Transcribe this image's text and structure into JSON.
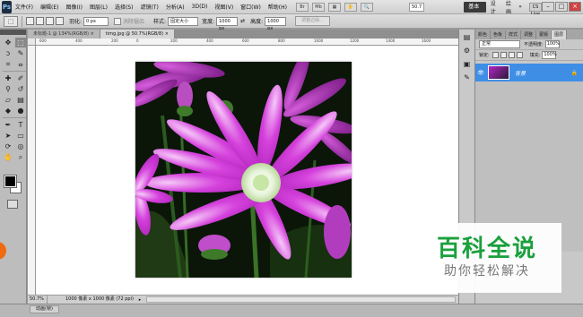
{
  "menubar": {
    "logo": "Ps",
    "items": [
      "文件(F)",
      "编辑(E)",
      "图像(I)",
      "图层(L)",
      "选择(S)",
      "滤镜(T)",
      "分析(A)",
      "3D(D)",
      "视图(V)",
      "窗口(W)",
      "帮助(H)"
    ],
    "zoom": "50.7",
    "workspace_active": "基本功能",
    "workspace_items": [
      "设计",
      "绘画"
    ],
    "more": "»",
    "cs_live": "CS Live"
  },
  "optbar": {
    "feather_label": "羽化:",
    "feather_value": "0 px",
    "antialias_label": "消除锯齿",
    "style_label": "样式:",
    "style_value": "固定大小",
    "width_label": "宽度:",
    "width_value": "1000 px",
    "height_label": "高度:",
    "height_value": "1000 px",
    "refine_button": "调整边缘..."
  },
  "doc_tabs": [
    {
      "label": "未标题-1 @ 134%(RGB/8) ×",
      "active": false
    },
    {
      "label": "timg.jpg @ 50.7%(RGB/8) ×",
      "active": true
    }
  ],
  "ruler_labels": [
    "600",
    "400",
    "200",
    "0",
    "200",
    "400",
    "600",
    "800",
    "1000",
    "1200",
    "1400",
    "1600"
  ],
  "statusbar": {
    "zoom": "50.7%",
    "doc_info": "1000 像素 x 1000 像素 (72 ppi)"
  },
  "bottom_panel": {
    "tab": "动画(帧)"
  },
  "layers_panel": {
    "tabs": [
      "颜色",
      "色板",
      "样式",
      "调整",
      "蒙版",
      "图层"
    ],
    "blend_mode": "正常",
    "opacity_label": "不透明度:",
    "opacity": "100%",
    "lock_label": "锁定:",
    "fill_label": "填充:",
    "fill": "100%",
    "layer_name": "背景"
  },
  "watermark": {
    "title": "百科全说",
    "subtitle": "助你轻松解决"
  },
  "colors": {
    "accent": "#3f8ee6",
    "watermark_green": "#1aa03c"
  }
}
